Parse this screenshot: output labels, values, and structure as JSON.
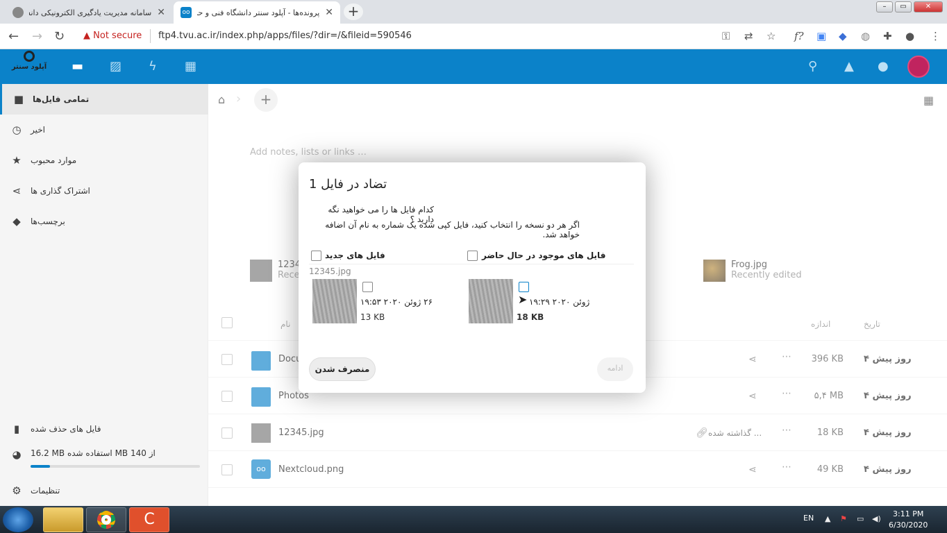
{
  "browser": {
    "tabs": [
      {
        "title": "سامانه مدیریت یادگیری الکترونیکی دانشگاه ف"
      },
      {
        "title": "پرونده‌ها - آپلود سنتر دانشگاه فنی و حرفه‌"
      }
    ],
    "not_secure": "Not secure",
    "url": "ftp4.tvu.ac.ir/index.php/apps/files/?dir=/&fileid=590546",
    "new_tab": "+"
  },
  "header": {
    "logo_text": "آپلود سنتر"
  },
  "sidebar": {
    "items": [
      {
        "label": "تمامی فایل‌ها"
      },
      {
        "label": "اخیر"
      },
      {
        "label": "موارد محبوب"
      },
      {
        "label": "اشتراک گذاری ها"
      },
      {
        "label": "برچسب‌ها"
      }
    ],
    "deleted": "فایل های حذف شده",
    "quota": "16.2 MB استفاده شده MB از 140",
    "quota_fraction": 0.116,
    "settings": "تنظیمات"
  },
  "main": {
    "notes_placeholder": "Add notes, lists or links …",
    "recent": [
      {
        "name": "1234",
        "sub": "Rece"
      },
      {
        "name": "Frog.jpg",
        "sub": "Recently edited"
      }
    ],
    "columns": {
      "name": "نام",
      "size": "اندازه",
      "date": "تاریخ"
    },
    "files": [
      {
        "name": "Docu",
        "size": "396 KB",
        "date": "۴ روز پیش",
        "shared": ""
      },
      {
        "name": "Photos",
        "size": "۵,۴ MB",
        "date": "۴ روز پیش",
        "shared": ""
      },
      {
        "name": "12345.jpg",
        "size": "18 KB",
        "date": "۴ روز پیش",
        "shared": "گذاشته شده ..."
      },
      {
        "name": "Nextcloud.png",
        "size": "49 KB",
        "date": "۴ روز پیش",
        "shared": ""
      }
    ]
  },
  "modal": {
    "title": "تضاد در فایل 1",
    "question": "کدام فایل ها را می خواهید نگه دارید ؟",
    "explain": "اگر هر دو نسخه را انتخاب کنید، فایل کپی شده یک شماره به نام آن اضافه خواهد شد.",
    "new_files": "فایل های جدید",
    "existing_files": "فایل های موجود در حال حاضر",
    "filename": "12345.jpg",
    "new_date": "۲۶ ژوئن ۲۰۲۰ ۱۹:۵۳",
    "new_size": "13 KB",
    "existing_date": "ژوئن ۲۰۲۰ ۱۹:۲۹",
    "existing_size": "18 KB",
    "cancel": "منصرف شدن",
    "continue": "ادامه"
  },
  "taskbar": {
    "lang": "EN",
    "time": "3:11 PM",
    "date": "6/30/2020"
  }
}
